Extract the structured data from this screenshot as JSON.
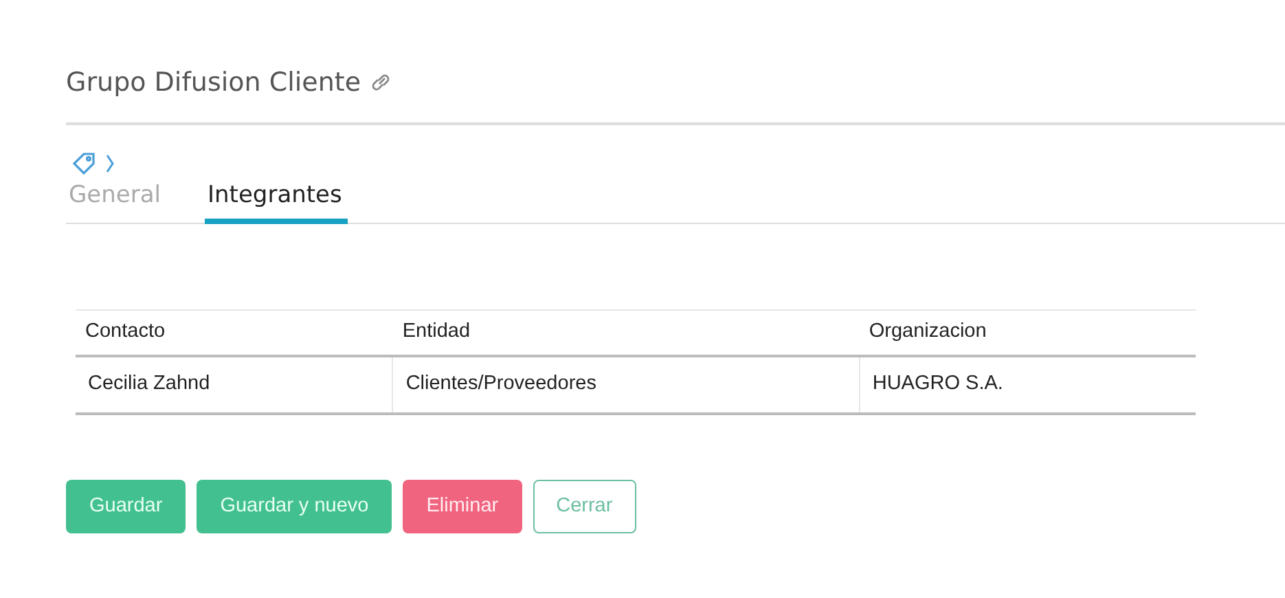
{
  "title": "Grupo Difusion Cliente",
  "tabs": [
    {
      "label": "General",
      "selected": false
    },
    {
      "label": "Integrantes",
      "selected": true
    }
  ],
  "table": {
    "columns": [
      "Contacto",
      "Entidad",
      "Organizacion"
    ],
    "rows": [
      [
        "Cecilia Zahnd",
        "Clientes/Proveedores",
        "HUAGRO S.A."
      ]
    ]
  },
  "buttons": [
    {
      "label": "Guardar",
      "kind": "success"
    },
    {
      "label": "Guardar y nuevo",
      "kind": "success"
    },
    {
      "label": "Eliminar",
      "kind": "danger"
    },
    {
      "label": "Cerrar",
      "kind": "outline"
    }
  ]
}
